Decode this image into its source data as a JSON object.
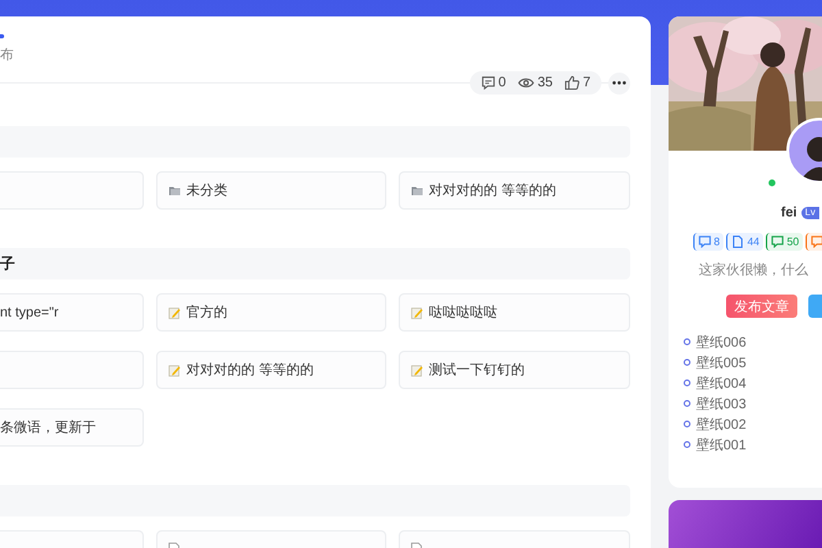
{
  "post_meta": {
    "author_online": true,
    "date_fragment": "布"
  },
  "stats": [
    {
      "kind": "comments",
      "value": "0"
    },
    {
      "kind": "views",
      "value": "35"
    },
    {
      "kind": "likes",
      "value": "7"
    }
  ],
  "sections": [
    {
      "cards": [
        {
          "kind": "category",
          "cut_left": true
        },
        {
          "kind": "category",
          "label": "未分类"
        },
        {
          "kind": "category",
          "label": "对对对的的 等等的的"
        }
      ]
    },
    {
      "title": "子",
      "cards": [
        {
          "kind": "post",
          "cut_left": true,
          "label": "nt type=\"r"
        },
        {
          "kind": "post",
          "label": "官方的"
        },
        {
          "kind": "post",
          "label": "哒哒哒哒哒"
        },
        {
          "kind": "post",
          "cut_left": true
        },
        {
          "kind": "post",
          "label": "对对对的的 等等的的"
        },
        {
          "kind": "post",
          "label": "测试一下钉钉的"
        },
        {
          "kind": "post",
          "cut_left": true,
          "label": "条微语，更新于"
        }
      ]
    },
    {
      "cards": [
        {
          "kind": "page",
          "cut_left": true
        },
        {
          "kind": "page"
        },
        {
          "kind": "page"
        }
      ]
    }
  ],
  "profile": {
    "cover": {
      "kind": "picture"
    },
    "online": true,
    "name": "fei",
    "level_badge": "Lv",
    "counts": [
      {
        "kind": "comments",
        "value": "8",
        "color": "#3b82f6"
      },
      {
        "kind": "posts",
        "value": "44",
        "color": "#3b82f6"
      },
      {
        "kind": "messages",
        "value": "50",
        "color": "#16a34a"
      },
      {
        "kind": "likes",
        "color": "#f97316"
      }
    ],
    "bio": "这家伙很懒，什么",
    "buttons": [
      {
        "kind": "primary",
        "label": "发布文章"
      },
      {
        "kind": "secondary"
      }
    ],
    "recent": [
      "壁纸006",
      "壁纸005",
      "壁纸004",
      "壁纸003",
      "壁纸002",
      "壁纸001"
    ]
  }
}
